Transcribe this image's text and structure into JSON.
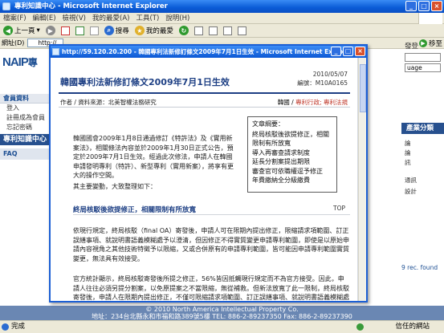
{
  "browser": {
    "title": "專利知識中心 - Microsoft Internet Explorer",
    "menu": [
      "檔案(F)",
      "編輯(E)",
      "檢視(V)",
      "我的最愛(A)",
      "工具(T)",
      "說明(H)"
    ],
    "toolbar": {
      "back": "上一頁",
      "search": "搜尋",
      "favorites": "我的最愛"
    },
    "address_label": "網址(D)",
    "address_value": "http://",
    "links_label": "移至",
    "status_left": "完成",
    "status_right": "信任的網站"
  },
  "background_page": {
    "logo": "NAIP",
    "logo_suffix": "專",
    "sidebar": {
      "header": "會員資料",
      "items": [
        "登入",
        "註冊成為會員",
        "忘記密碼"
      ],
      "section": "專利知識中心",
      "faq": "FAQ"
    },
    "right": {
      "login": "發登",
      "dropdown1": "",
      "dropdown2": "uage",
      "panel_title": "產業分類",
      "items": [
        "論",
        "論",
        "訊",
        "通訊",
        "設計"
      ],
      "records": "9 rec. found"
    },
    "footer_line1": "© 2010 North America Intellectual Property Co.",
    "footer_line2": "地址：234台北縣永和市福和路389號5樓  TEL: 886-2-89237350 Fax: 886-2-89237390"
  },
  "popup": {
    "title": "http://59.120.20.200 - 韓國專利法新修訂條文2009年7月1日生效 - Microsoft Internet Explorer",
    "article": {
      "title": "韓國專利法新修訂條文2009年7月1日生效",
      "date": "2010/05/07",
      "id_label": "編號：M10A0165",
      "author": "作者 / 資料來源：北美智權法務研究",
      "category_label": "韓國 / ",
      "category_link": "專利行政; 專利法規",
      "summary_title": "文章綱要：",
      "summary_items": [
        "終局核駁後欲提修正，相關限制有所放寬",
        "導入再審查請求制度",
        "延長分割案提出期限",
        "審查官可依職權逕予修正",
        "年費繳納全分級繳費"
      ],
      "paragraph1": "韓國國會2009年1月8日通過修訂《特許法》及《實用新案法》，相關條法內容並於2009年1月30日正式公告，預定於2009年7月1日生效。經過此次修法，申請人在韓國申請發明專利（特許）、新型專利（實用新案），將享有更大的操作空間。",
      "paragraph2": "其主要變動，大致整理如下：",
      "section1_title": "終局核駁後欲提修正，相關限制有所放寬",
      "top_link": "TOP",
      "paragraph3": "依現行規定，終局核駁（final OA）寄發後，申請人可在限期內提出修正，限縮請求項範圍、訂正誤繕事項、就說明書語義模糊處予以澄清，但因修正不得實質變更申請專利範圍，即使是以原始申請內容視角之其他技術特徵予以限縮，又或合併原有的申請專利範圍，皆可能因申請專利範圍實質變更，無法具有效接受。",
      "paragraph4": "官方統計顯示，終局核駁寄發後所提之修正，56%皆因抵觸現行規定而不為官方接受。因此，申請人往往必須另提分割案，以免原提案之不當限縮，無從補救。但新法放寬了此一限制，終局核駁寄發後，申請人在限期內提出修正，不僅可限縮請求項範圍、訂正誤繕事項、就說明書語義模糊處予以澄清，亦可刪減超出原始揭露之範圍之修正內容，又或者合併既有申請專利範圍…"
    }
  }
}
